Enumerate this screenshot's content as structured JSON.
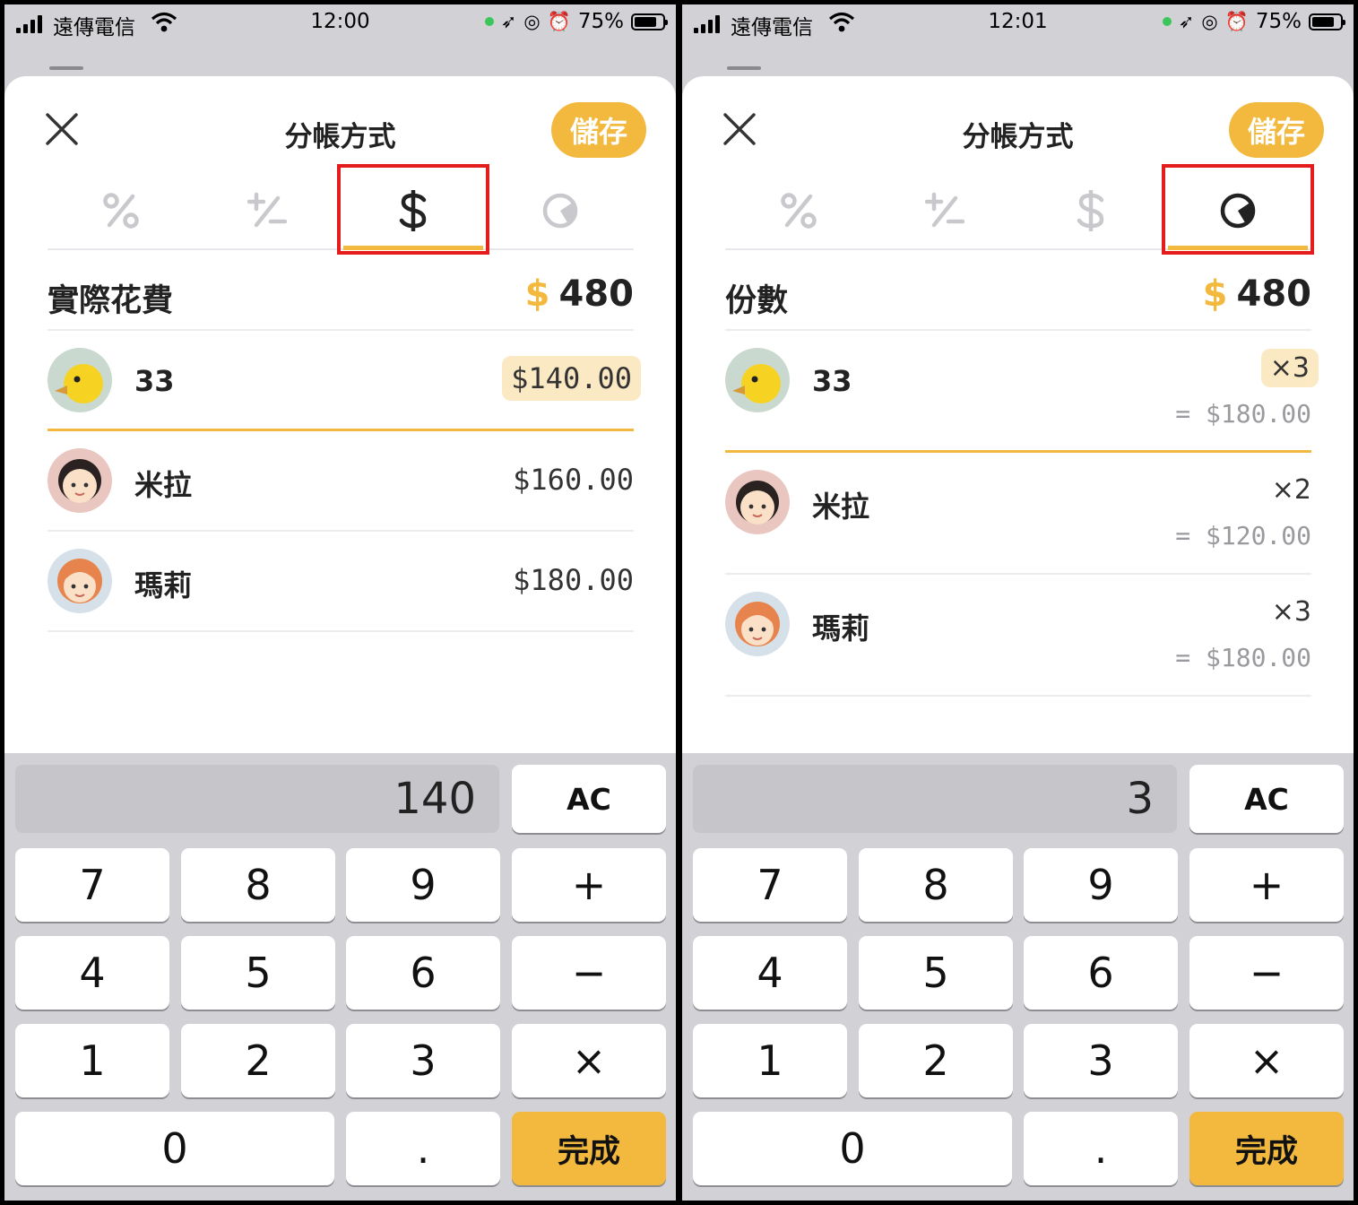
{
  "screens": [
    {
      "status": {
        "carrier": "遠傳電信",
        "time": "12:00",
        "battery": "75%"
      },
      "title": "分帳方式",
      "save_label": "儲存",
      "tabs": [
        "%",
        "+/-",
        "$",
        "份數圖"
      ],
      "active_tab": 2,
      "section": {
        "title": "實際花費",
        "currency": "$",
        "total": "480"
      },
      "members": [
        {
          "name": "33",
          "amount": "$140.00",
          "selected": true
        },
        {
          "name": "米拉",
          "amount": "$160.00",
          "selected": false
        },
        {
          "name": "瑪莉",
          "amount": "$180.00",
          "selected": false
        }
      ],
      "keypad": {
        "display": "140",
        "keys": [
          "AC",
          "7",
          "8",
          "9",
          "+",
          "4",
          "5",
          "6",
          "−",
          "1",
          "2",
          "3",
          "×",
          "0",
          ".",
          "完成"
        ]
      }
    },
    {
      "status": {
        "carrier": "遠傳電信",
        "time": "12:01",
        "battery": "75%"
      },
      "title": "分帳方式",
      "save_label": "儲存",
      "tabs": [
        "%",
        "+/-",
        "$",
        "份數圖"
      ],
      "active_tab": 3,
      "section": {
        "title": "份數",
        "currency": "$",
        "total": "480"
      },
      "members": [
        {
          "name": "33",
          "share": "×3",
          "amount": "= $180.00",
          "selected": true
        },
        {
          "name": "米拉",
          "share": "×2",
          "amount": "= $120.00",
          "selected": false
        },
        {
          "name": "瑪莉",
          "share": "×3",
          "amount": "= $180.00",
          "selected": false
        }
      ],
      "keypad": {
        "display": "3",
        "keys": [
          "AC",
          "7",
          "8",
          "9",
          "+",
          "4",
          "5",
          "6",
          "−",
          "1",
          "2",
          "3",
          "×",
          "0",
          ".",
          "完成"
        ]
      }
    }
  ],
  "colors": {
    "accent": "#f3b93f",
    "highlight_box": "#e51c1c",
    "selected_bg": "#fbe9c4"
  },
  "icons": [
    "cellular-signal-icon",
    "wifi-icon",
    "location-arrow-icon",
    "orientation-lock-icon",
    "alarm-icon",
    "battery-icon",
    "close-icon",
    "percent-icon",
    "plus-minus-icon",
    "dollar-icon",
    "pie-shares-icon"
  ]
}
